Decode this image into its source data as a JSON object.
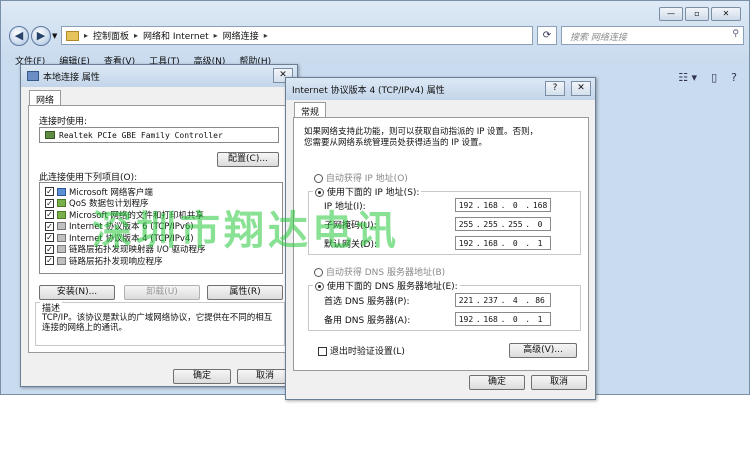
{
  "explorer": {
    "breadcrumb": [
      "控制面板",
      "网络和 Internet",
      "网络连接"
    ],
    "search_placeholder": "搜索 网络连接",
    "menu": [
      "文件(F)",
      "编辑(E)",
      "查看(V)",
      "工具(T)",
      "高级(N)",
      "帮助(H)"
    ]
  },
  "local_props": {
    "title": "本地连接 属性",
    "tab": "网络",
    "connect_using_label": "连接时使用:",
    "adapter": "Realtek PCIe GBE Family Controller",
    "configure_button": "配置(C)...",
    "components_label": "此连接使用下列项目(O):",
    "components": [
      "Microsoft 网络客户端",
      "QoS 数据包计划程序",
      "Microsoft 网络的文件和打印机共享",
      "Internet 协议版本 6 (TCP/IPv6)",
      "Internet 协议版本 4 (TCP/IPv4)",
      "链路层拓扑发现映射器 I/O 驱动程序",
      "链路层拓扑发现响应程序"
    ],
    "install_button": "安装(N)...",
    "uninstall_button": "卸载(U)",
    "properties_button": "属性(R)",
    "description_label": "描述",
    "description_text": "TCP/IP。该协议是默认的广域网络协议，它提供在不同的相互连接的网络上的通讯。",
    "ok_button": "确定",
    "cancel_button": "取消"
  },
  "ipv4_props": {
    "title": "Internet 协议版本 4 (TCP/IPv4) 属性",
    "help_button": "?",
    "tab": "常规",
    "intro_line1": "如果网络支持此功能，则可以获取自动指派的 IP 设置。否则，",
    "intro_line2": "您需要从网络系统管理员处获得适当的 IP 设置。",
    "auto_ip": "自动获得 IP 地址(O)",
    "manual_ip": "使用下面的 IP 地址(S):",
    "ip_label": "IP 地址(I):",
    "ip_value": [
      "192",
      "168",
      "0",
      "168"
    ],
    "subnet_label": "子网掩码(U):",
    "subnet_value": [
      "255",
      "255",
      "255",
      "0"
    ],
    "gateway_label": "默认网关(D):",
    "gateway_value": [
      "192",
      "168",
      "0",
      "1"
    ],
    "auto_dns": "自动获得 DNS 服务器地址(B)",
    "manual_dns": "使用下面的 DNS 服务器地址(E):",
    "dns1_label": "首选 DNS 服务器(P):",
    "dns1_value": [
      "221",
      "237",
      "4",
      "86"
    ],
    "dns2_label": "备用 DNS 服务器(A):",
    "dns2_value": [
      "192",
      "168",
      "0",
      "1"
    ],
    "validate_label": "退出时验证设置(L)",
    "advanced_button": "高级(V)...",
    "ok_button": "确定",
    "cancel_button": "取消"
  },
  "watermark": "深圳市翔达电讯"
}
